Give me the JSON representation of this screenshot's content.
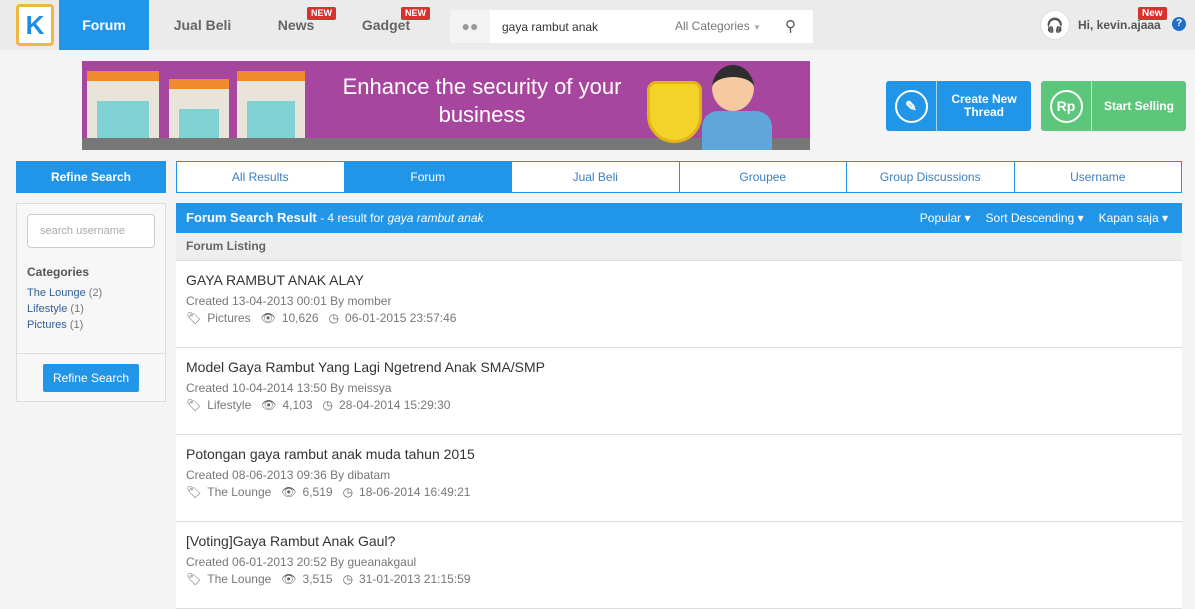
{
  "header": {
    "logo": "K",
    "nav": [
      {
        "label": "Forum",
        "active": true
      },
      {
        "label": "Jual Beli"
      },
      {
        "label": "News",
        "badge": "NEW"
      },
      {
        "label": "Gadget",
        "badge": "NEW"
      }
    ],
    "search": {
      "value": "gaya rambut anak",
      "category": "All Categories"
    },
    "user": {
      "greeting": "Hi, kevin.ajaaa",
      "badge": "New"
    }
  },
  "banner": {
    "text": "Enhance the security of your business",
    "shield_text": "SECURITY"
  },
  "actions": {
    "create": "Create New Thread",
    "sell": "Start Selling",
    "sell_icon": "Rp"
  },
  "sidebar": {
    "title": "Refine Search",
    "username_placeholder": "search username",
    "categories_title": "Categories",
    "categories": [
      {
        "name": "The Lounge",
        "count": "(2)"
      },
      {
        "name": "Lifestyle",
        "count": "(1)"
      },
      {
        "name": "Pictures",
        "count": "(1)"
      }
    ],
    "button": "Refine Search"
  },
  "tabs": [
    {
      "label": "All Results"
    },
    {
      "label": "Forum",
      "active": true
    },
    {
      "label": "Jual Beli"
    },
    {
      "label": "Groupee"
    },
    {
      "label": "Group Discussions"
    },
    {
      "label": "Username"
    }
  ],
  "results": {
    "title": "Forum Search Result",
    "summary": " - 4 result for ",
    "query": "gaya rambut anak",
    "sorts": [
      "Popular",
      "Sort Descending",
      "Kapan saja"
    ],
    "listing": "Forum Listing",
    "items": [
      {
        "title": "GAYA RAMBUT ANAK ALAY",
        "meta": "Created 13-04-2013 00:01 By momber",
        "category": "Pictures",
        "views": "10,626",
        "last": "06-01-2015 23:57:46"
      },
      {
        "title": "Model Gaya Rambut Yang Lagi Ngetrend Anak SMA/SMP",
        "meta": "Created 10-04-2014 13:50 By meissya",
        "category": "Lifestyle",
        "views": "4,103",
        "last": "28-04-2014 15:29:30"
      },
      {
        "title": "Potongan gaya rambut anak muda tahun 2015",
        "meta": "Created 08-06-2013 09:36 By dibatam",
        "category": "The Lounge",
        "views": "6,519",
        "last": "18-06-2014 16:49:21"
      },
      {
        "title": "[Voting]Gaya Rambut Anak Gaul?",
        "meta": "Created 06-01-2013 20:52 By gueanakgaul",
        "category": "The Lounge",
        "views": "3,515",
        "last": "31-01-2013 21:15:59"
      }
    ]
  },
  "colors": {
    "primary": "#2196e8",
    "green": "#5cc77a",
    "badge": "#d9312f",
    "banner": "#a7469f"
  }
}
